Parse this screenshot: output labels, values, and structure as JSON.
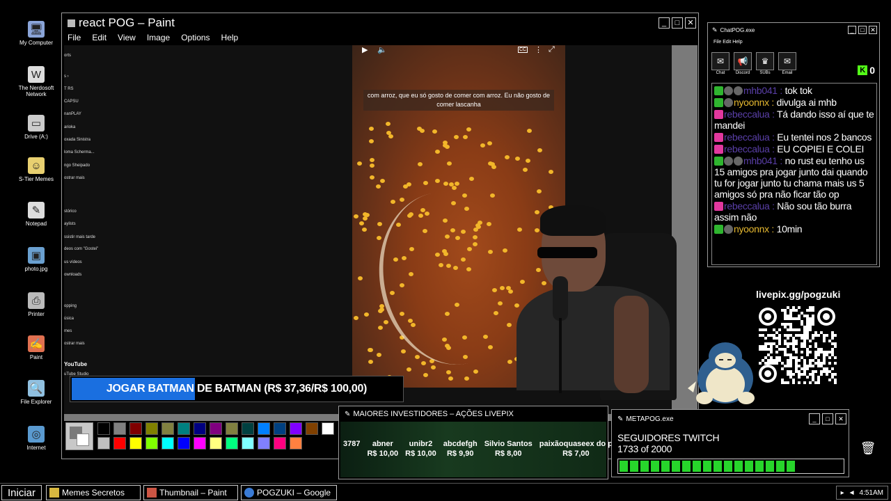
{
  "desktop": {
    "icons": [
      {
        "label": "My Computer",
        "icon": "computer-icon"
      },
      {
        "label": "The Nerdosoft Network",
        "icon": "network-icon"
      },
      {
        "label": "Drive (A:)",
        "icon": "drive-icon"
      },
      {
        "label": "S-Tier Memes",
        "icon": "folder-icon"
      },
      {
        "label": "Notepad",
        "icon": "notepad-icon"
      },
      {
        "label": "photo.jpg",
        "icon": "image-icon"
      },
      {
        "label": "Printer",
        "icon": "printer-icon"
      },
      {
        "label": "Paint",
        "icon": "paint-icon"
      },
      {
        "label": "File Explorer",
        "icon": "file-explorer-icon"
      },
      {
        "label": "Internet",
        "icon": "internet-icon"
      }
    ]
  },
  "paint": {
    "title": "react POG – Paint",
    "menu": [
      "File",
      "Edit",
      "View",
      "Image",
      "Options",
      "Help"
    ],
    "caption": "com arroz, que eu só gosto de comer com arroz. Eu não gosto de comer lascanha",
    "yt_sidebar": [
      "orts",
      "s ›",
      "T RS",
      "CAPSU",
      "nanPLAY",
      "arioka",
      "oxada Sinistra",
      "loma Scherma...",
      "ngo Sheipado",
      "ostrar mais",
      "stórico",
      "aylists",
      "ssistir mais tarde",
      "deos com \"Gostei\"",
      "us vídeos",
      "ownloads",
      "opping",
      "úsica",
      "mes",
      "ostrar mais",
      "YouTube",
      "uTube Studio"
    ],
    "palette_colors": [
      "#000000",
      "#808080",
      "#800000",
      "#808000",
      "#808040",
      "#008080",
      "#000080",
      "#800080",
      "#808040",
      "#004040",
      "#0080ff",
      "#004080",
      "#8000ff",
      "#804000",
      "#ffffff",
      "#c0c0c0",
      "#ff0000",
      "#ffff00",
      "#80ff00",
      "#00ffff",
      "#0000ff",
      "#ff00ff",
      "#ffff80",
      "#00ff80",
      "#80ffff",
      "#8080ff",
      "#ff0080",
      "#ff8040"
    ]
  },
  "goal_banner": {
    "text": "JOGAR BATMAN DE BATMAN (R$ 37,36/R$ 100,00)",
    "progress": 0.3736,
    "color": "#1a6fe0"
  },
  "chat": {
    "title": "ChatPOG.exe",
    "menu": "File Edit Help",
    "tools": [
      {
        "label": "Chat",
        "icon": "chat-icon"
      },
      {
        "label": "Discord",
        "icon": "discord-icon"
      },
      {
        "label": "SUBs",
        "icon": "subs-icon"
      },
      {
        "label": "Email",
        "icon": "email-icon"
      }
    ],
    "kick_count": "0",
    "messages": [
      {
        "user": "mhb041",
        "text": "tok tok",
        "color": "purple",
        "badges": [
          "green",
          "grey",
          "grey"
        ]
      },
      {
        "user": "nyoonnx",
        "text": "divulga ai mhb",
        "color": "gold",
        "badges": [
          "green",
          "grey"
        ]
      },
      {
        "user": "rebeccalua",
        "text": "Tá dando isso aí que te mandei",
        "color": "purple",
        "badges": [
          "pink"
        ]
      },
      {
        "user": "rebeccalua",
        "text": "Eu tentei nos 2 bancos",
        "color": "purple",
        "badges": [
          "pink"
        ]
      },
      {
        "user": "rebeccalua",
        "text": "EU COPIEI E COLEI",
        "color": "purple",
        "badges": [
          "pink"
        ]
      },
      {
        "user": "mhb041",
        "text": "no rust eu tenho us 15 amigos pra jogar junto dai quando tu for jogar junto tu chama mais us 5 amigos só pra não ficar tão op",
        "color": "purple",
        "badges": [
          "green",
          "grey",
          "grey"
        ]
      },
      {
        "user": "rebeccalua",
        "text": "Não sou tão burra assim não",
        "color": "purple",
        "badges": [
          "pink"
        ]
      },
      {
        "user": "nyoonnx",
        "text": "10min",
        "color": "gold",
        "badges": [
          "green",
          "grey"
        ]
      }
    ]
  },
  "livepix": {
    "url": "livepix.gg/pogzuki"
  },
  "investors": {
    "title": "MAIORES INVESTIDORES – AÇÕES LIVEPIX",
    "entries": [
      {
        "name": "3787",
        "value": ""
      },
      {
        "name": "abner",
        "value": "R$ 10,00"
      },
      {
        "name": "unibr2",
        "value": "R$ 10,00"
      },
      {
        "name": "abcdefgh",
        "value": "R$ 9,90"
      },
      {
        "name": "Silvio Santos",
        "value": "R$ 8,00"
      },
      {
        "name": "paixãoquaseex do p",
        "value": "R$ 7,00"
      }
    ]
  },
  "metapog": {
    "title": "METAPOG.exe",
    "label": "SEGUIDORES TWITCH",
    "count_text": "1733 of 2000",
    "progress": 0.8665,
    "bar_color": "#27d52b"
  },
  "taskbar": {
    "start": "Iniciar",
    "tasks": [
      "Memes Secretos",
      "Thumbnail – Paint",
      "POGZUKI – Google"
    ],
    "time": "4:51AM"
  }
}
